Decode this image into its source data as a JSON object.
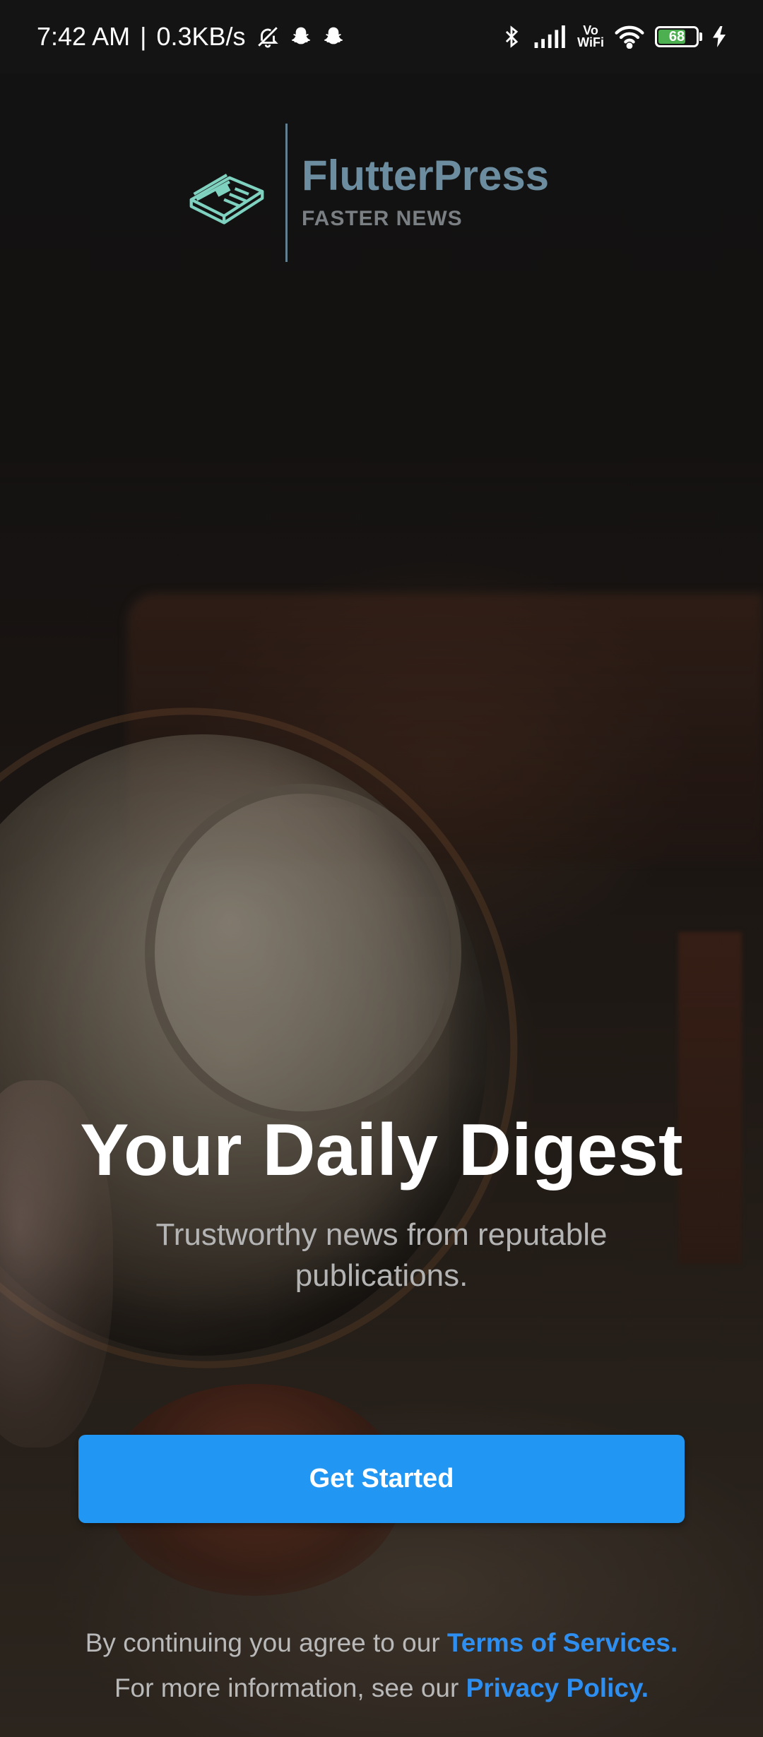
{
  "status_bar": {
    "time": "7:42 AM",
    "separator": "|",
    "net_speed": "0.3KB/s",
    "vowifi_top": "Vo",
    "vowifi_bottom": "WiFi",
    "battery_level": "68",
    "icons": [
      "bell-off-icon",
      "snapchat-icon",
      "snapchat-icon",
      "bluetooth-icon",
      "signal-icon",
      "vowifi-icon",
      "wifi-icon",
      "battery-icon",
      "charging-icon"
    ]
  },
  "logo": {
    "title": "FlutterPress",
    "subtitle": "FASTER NEWS",
    "mark_icon": "newspaper-icon",
    "colors": {
      "mark": "#7fd1c0",
      "title": "#6c8da0",
      "subtitle": "#7a7f84"
    }
  },
  "hero": {
    "headline": "Your Daily Digest",
    "subtitle": "Trustworthy news from reputable publications."
  },
  "cta": {
    "label": "Get Started",
    "color": "#2196f3"
  },
  "legal": {
    "line1_prefix": "By continuing you agree to our",
    "terms_link": "Terms of Services.",
    "line2_prefix": "For more information, see our",
    "privacy_link": "Privacy Policy.",
    "link_color": "#2e8ff0"
  }
}
